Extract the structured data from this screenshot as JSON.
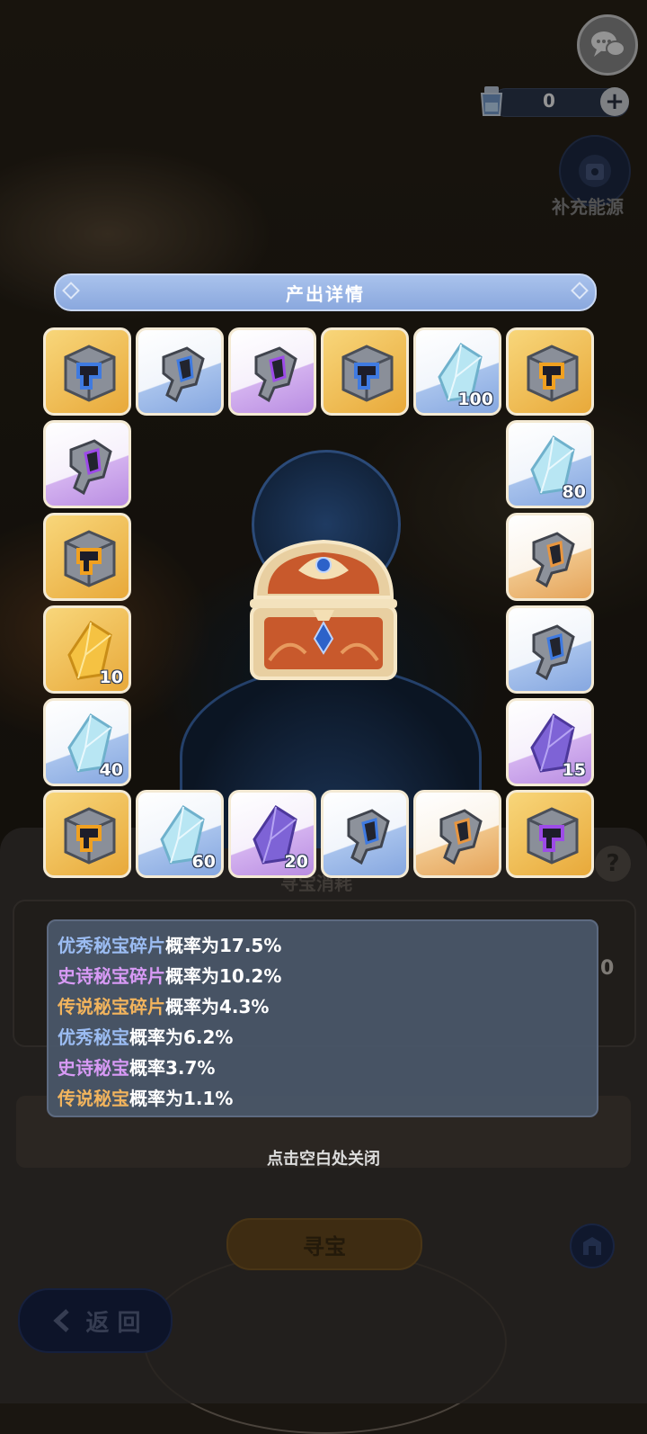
{
  "hud": {
    "energy_value": "0",
    "refill_label": "补充能源"
  },
  "background_panel": {
    "section_title": "寻宝消耗",
    "side_value": "0",
    "search_button": "寻宝",
    "back_button": "返 回"
  },
  "modal": {
    "title": "产出详情",
    "tiles": [
      {
        "rarity": "gold",
        "item": "cube-relic",
        "count": ""
      },
      {
        "rarity": "blue",
        "item": "relic-fragment",
        "count": ""
      },
      {
        "rarity": "purple",
        "item": "relic-fragment",
        "count": ""
      },
      {
        "rarity": "gold",
        "item": "cube-relic",
        "count": ""
      },
      {
        "rarity": "blue",
        "item": "crystal",
        "count": "100"
      },
      {
        "rarity": "gold",
        "item": "cube-relic",
        "count": ""
      },
      {
        "rarity": "purple",
        "item": "relic-fragment",
        "count": ""
      },
      {
        "rarity": "blue",
        "item": "crystal",
        "count": "80"
      },
      {
        "rarity": "gold",
        "item": "cube-relic",
        "count": ""
      },
      {
        "rarity": "orange",
        "item": "relic-fragment",
        "count": ""
      },
      {
        "rarity": "gold",
        "item": "gold-crystal",
        "count": "10"
      },
      {
        "rarity": "blue",
        "item": "relic-fragment",
        "count": ""
      },
      {
        "rarity": "blue",
        "item": "crystal",
        "count": "40"
      },
      {
        "rarity": "purple",
        "item": "purple-crystal",
        "count": "15"
      },
      {
        "rarity": "gold",
        "item": "cube-relic",
        "count": ""
      },
      {
        "rarity": "blue",
        "item": "crystal",
        "count": "60"
      },
      {
        "rarity": "purple",
        "item": "purple-crystal",
        "count": "20"
      },
      {
        "rarity": "blue",
        "item": "relic-fragment",
        "count": ""
      },
      {
        "rarity": "orange",
        "item": "relic-fragment",
        "count": ""
      },
      {
        "rarity": "gold",
        "item": "cube-relic",
        "count": ""
      }
    ],
    "probabilities": [
      {
        "name": "优秀秘宝碎片",
        "text": "概率为17.5%",
        "color": "#9bbcf2"
      },
      {
        "name": "史诗秘宝碎片",
        "text": "概率为10.2%",
        "color": "#d79af5"
      },
      {
        "name": "传说秘宝碎片",
        "text": "概率为4.3%",
        "color": "#f2b45d"
      },
      {
        "name": "优秀秘宝",
        "text": "概率为6.2%",
        "color": "#9bbcf2"
      },
      {
        "name": "史诗秘宝",
        "text": "概率3.7%",
        "color": "#d79af5"
      },
      {
        "name": "传说秘宝",
        "text": "概率为1.1%",
        "color": "#f2b45d"
      }
    ],
    "close_hint": "点击空白处关闭"
  }
}
